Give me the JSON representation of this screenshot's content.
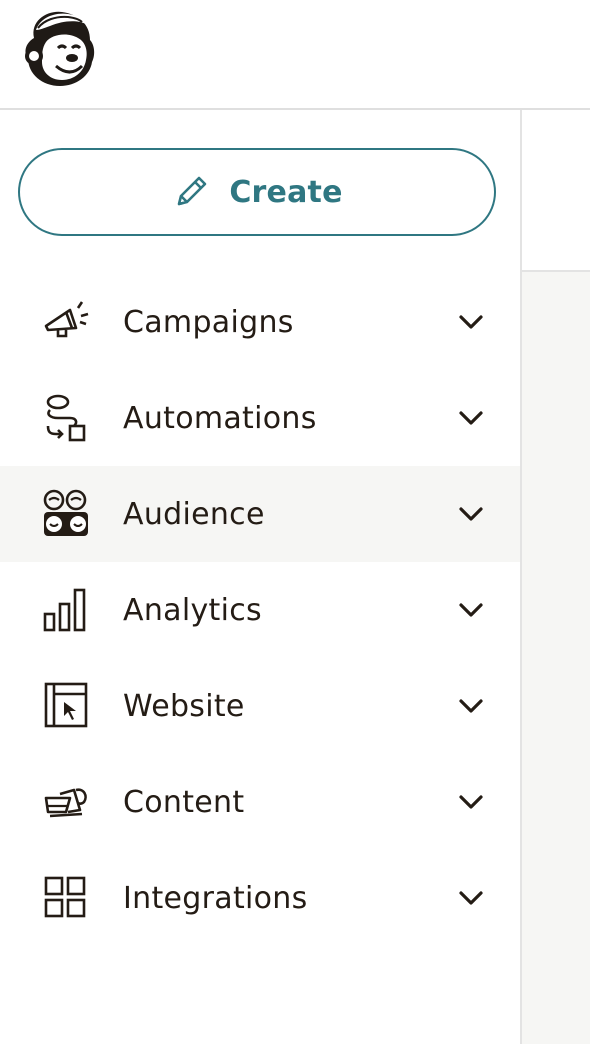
{
  "brand": {
    "logo_icon": "freddie-monkey-logo-icon"
  },
  "sidebar": {
    "create_label": "Create",
    "create_icon": "pencil-icon",
    "accent_color": "#2f7782",
    "active_item": "Audience",
    "items": [
      {
        "label": "Campaigns",
        "icon": "megaphone-icon"
      },
      {
        "label": "Automations",
        "icon": "automation-flow-icon"
      },
      {
        "label": "Audience",
        "icon": "audience-faces-icon"
      },
      {
        "label": "Analytics",
        "icon": "bar-chart-icon"
      },
      {
        "label": "Website",
        "icon": "website-cursor-icon"
      },
      {
        "label": "Content",
        "icon": "content-icon"
      },
      {
        "label": "Integrations",
        "icon": "grid-icon"
      }
    ]
  }
}
